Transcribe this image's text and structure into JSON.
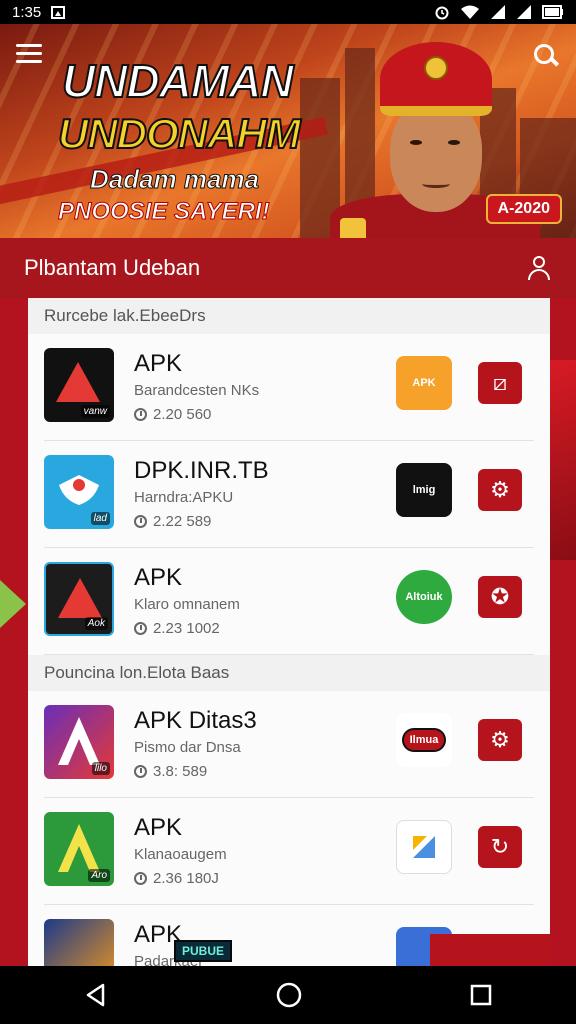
{
  "status_bar": {
    "time": "1:35",
    "icons": [
      "image-icon",
      "alarm-icon",
      "wifi-icon",
      "signal-icon",
      "signal-icon",
      "battery-icon"
    ]
  },
  "banner": {
    "title_line1": "UNDAMAN",
    "title_line2": "UNDONAHM",
    "subtitle_line1": "Dadam mama",
    "subtitle_line2": "PNOOSIE SAYERI!",
    "badge": "A-2020"
  },
  "section": {
    "title": "Plbantam Udeban"
  },
  "groups": [
    {
      "label": "Rurcebe lak.EbeeDrs",
      "apps": [
        {
          "name": "APK",
          "subtitle": "Barandcesten NKs",
          "meta": "2.20 560",
          "icon_color": "#111111",
          "icon_tag": "vanw",
          "mini_logo_color": "#f5a12a",
          "mini_logo_text": "APK",
          "action_icon": "link-icon"
        },
        {
          "name": "DPK.INR.TB",
          "subtitle": "Harndra:APKU",
          "meta": "2.22 589",
          "icon_color": "#29a8e0",
          "icon_tag": "lad",
          "mini_logo_color": "#111111",
          "mini_logo_text": "lmig",
          "action_icon": "gear-icon"
        },
        {
          "name": "APK",
          "subtitle": "Klaro omnanem",
          "meta": "2.23 1002",
          "icon_color": "#1c1c1c",
          "icon_tag": "Aok",
          "mini_logo_color": "#2eaa3e",
          "mini_logo_text": "Altoiuk",
          "action_icon": "settings-icon"
        }
      ]
    },
    {
      "label": "Pouncina lon.Elota Baas",
      "apps": [
        {
          "name": "APK Ditas3",
          "subtitle": "Pismo dar Dnsa",
          "meta": "3.8: 589",
          "icon_color": "#6a2fb8",
          "icon_tag": "lilo",
          "mini_logo_color": "#ffffff",
          "mini_logo_text": "Ilmua",
          "action_icon": "gear-icon"
        },
        {
          "name": "APK",
          "subtitle": "Klanaoaugem",
          "meta": "2.36 180J",
          "icon_color": "#2c9a3a",
          "icon_tag": "Aro",
          "mini_logo_color": "#ffffff",
          "mini_logo_text": "",
          "action_icon": "refresh-icon"
        },
        {
          "name": "APK",
          "subtitle": "Padarkaer",
          "meta": "",
          "icon_color": "#f59a1a",
          "icon_tag": "",
          "mini_logo_color": "#3a6fd8",
          "mini_logo_text": "",
          "action_icon": ""
        }
      ]
    }
  ],
  "promo_chip": "PUBUE",
  "nav": {
    "back": "back-button",
    "home": "home-button",
    "recents": "recents-button"
  }
}
